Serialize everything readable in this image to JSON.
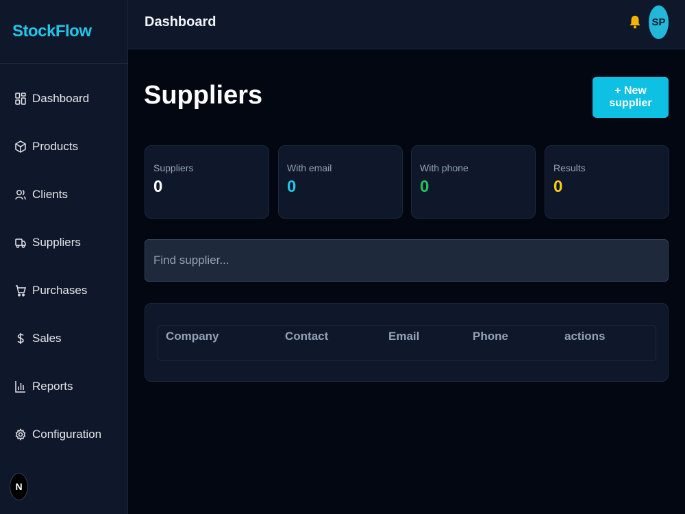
{
  "brand": {
    "name": "StockFlow",
    "color": "#22c5e8"
  },
  "sidebar": {
    "items": [
      {
        "label": "Dashboard",
        "icon": "dashboard-icon"
      },
      {
        "label": "Products",
        "icon": "package-icon"
      },
      {
        "label": "Clients",
        "icon": "users-icon"
      },
      {
        "label": "Suppliers",
        "icon": "truck-icon"
      },
      {
        "label": "Purchases",
        "icon": "cart-icon"
      },
      {
        "label": "Sales",
        "icon": "dollar-icon"
      },
      {
        "label": "Reports",
        "icon": "bar-chart-icon"
      },
      {
        "label": "Configuration",
        "icon": "gear-icon"
      }
    ],
    "badge": "N"
  },
  "header": {
    "title": "Dashboard",
    "bell_icon": "bell-icon",
    "avatar_initials": "SP"
  },
  "main": {
    "title": "Suppliers",
    "new_button": "+ New supplier",
    "stats": [
      {
        "label": "Suppliers",
        "value": "0",
        "color": "#ffffff"
      },
      {
        "label": "With email",
        "value": "0",
        "color": "#22c5e8"
      },
      {
        "label": "With phone",
        "value": "0",
        "color": "#22c55e"
      },
      {
        "label": "Results",
        "value": "0",
        "color": "#facc15"
      }
    ],
    "search": {
      "placeholder": "Find supplier...",
      "value": ""
    },
    "table": {
      "columns": [
        "Company",
        "Contact",
        "Email",
        "Phone",
        "actions"
      ],
      "rows": []
    }
  }
}
